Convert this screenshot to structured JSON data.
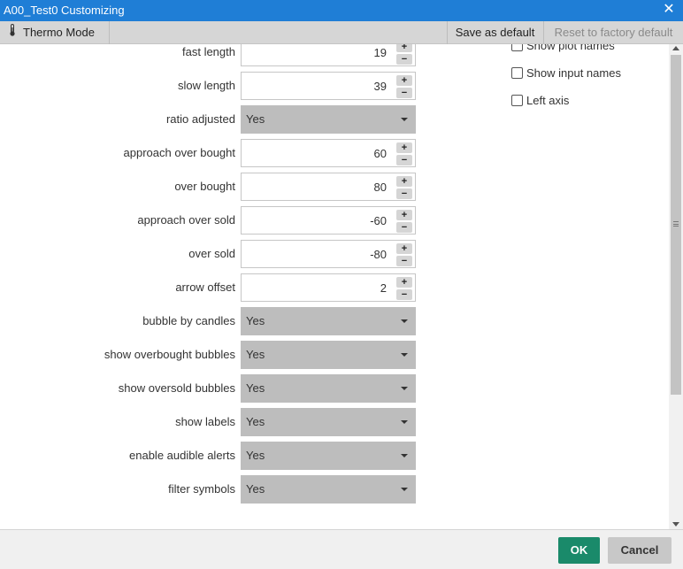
{
  "window": {
    "title": "A00_Test0 Customizing",
    "close_glyph": "✕"
  },
  "toolbar": {
    "thermo_label": "Thermo Mode",
    "thermo_icon": "thermometer-icon",
    "save_default_label": "Save as default",
    "reset_default_label": "Reset to factory default"
  },
  "inputs": [
    {
      "label": "fast length",
      "type": "number",
      "value": "19"
    },
    {
      "label": "slow length",
      "type": "number",
      "value": "39"
    },
    {
      "label": "ratio adjusted",
      "type": "select",
      "value": "Yes"
    },
    {
      "label": "approach over bought",
      "type": "number",
      "value": "60"
    },
    {
      "label": "over bought",
      "type": "number",
      "value": "80"
    },
    {
      "label": "approach over sold",
      "type": "number",
      "value": "-60"
    },
    {
      "label": "over sold",
      "type": "number",
      "value": "-80"
    },
    {
      "label": "arrow offset",
      "type": "number",
      "value": "2"
    },
    {
      "label": "bubble by candles",
      "type": "select",
      "value": "Yes"
    },
    {
      "label": "show overbought bubbles",
      "type": "select",
      "value": "Yes"
    },
    {
      "label": "show oversold bubbles",
      "type": "select",
      "value": "Yes"
    },
    {
      "label": "show labels",
      "type": "select",
      "value": "Yes"
    },
    {
      "label": "enable audible alerts",
      "type": "select",
      "value": "Yes"
    },
    {
      "label": "filter symbols",
      "type": "select",
      "value": "Yes"
    }
  ],
  "stepper": {
    "plus": "+",
    "minus": "−"
  },
  "options": [
    {
      "label": "Show plot names",
      "checked": false
    },
    {
      "label": "Show input names",
      "checked": false
    },
    {
      "label": "Left axis",
      "checked": false
    }
  ],
  "footer": {
    "ok_label": "OK",
    "cancel_label": "Cancel"
  }
}
